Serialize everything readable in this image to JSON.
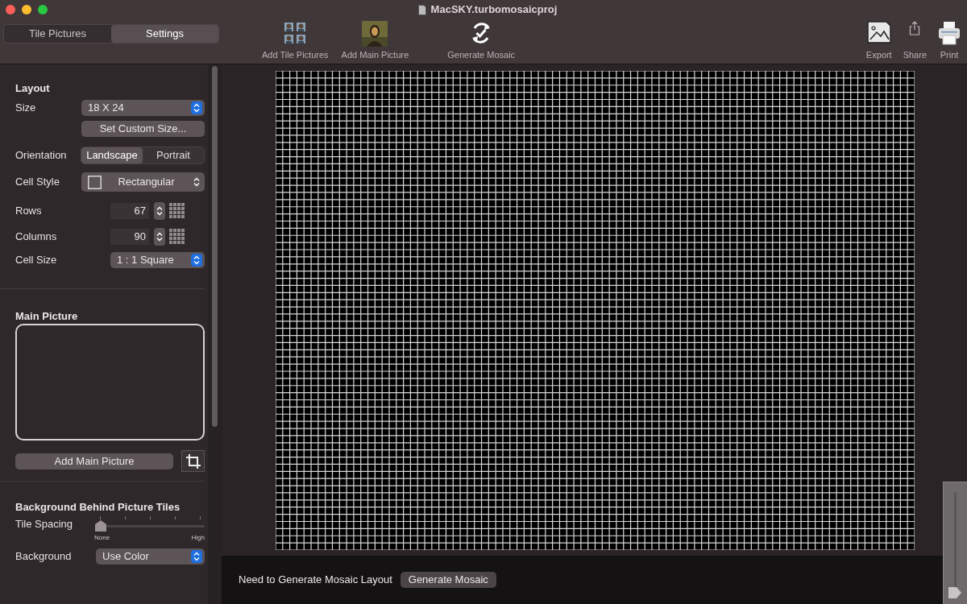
{
  "window": {
    "title": "MacSKY.turbomosaicproj"
  },
  "tabs": [
    {
      "label": "Tile Pictures",
      "selected": false
    },
    {
      "label": "Settings",
      "selected": true
    }
  ],
  "toolbar": {
    "left": [
      {
        "label": "Add Tile Pictures",
        "kind": "tiles"
      },
      {
        "label": "Add Main Picture",
        "kind": "portrait"
      },
      {
        "label": "Generate Mosaic",
        "kind": "generate"
      }
    ],
    "right": [
      {
        "label": "Export",
        "kind": "export"
      },
      {
        "label": "Share",
        "kind": "share"
      },
      {
        "label": "Print",
        "kind": "print"
      }
    ]
  },
  "layout": {
    "heading": "Layout",
    "size_label": "Size",
    "size_value": "18 X 24",
    "custom_size_button": "Set Custom Size...",
    "orientation_label": "Orientation",
    "orientations": [
      {
        "label": "Landscape",
        "selected": true
      },
      {
        "label": "Portrait",
        "selected": false
      }
    ],
    "cell_style_label": "Cell Style",
    "cell_style_value": "Rectangular",
    "rows_label": "Rows",
    "rows_value": "67",
    "columns_label": "Columns",
    "columns_value": "90",
    "cell_size_label": "Cell Size",
    "cell_size_value": "1 : 1 Square"
  },
  "main_picture": {
    "heading": "Main Picture",
    "button": "Add Main Picture"
  },
  "background": {
    "heading": "Background Behind Picture Tiles",
    "spacing_label": "Tile Spacing",
    "tile_spacing": {
      "level": 0
    },
    "spacing_min": "None",
    "spacing_max": "High",
    "background_label": "Background",
    "background_value": "Use Color"
  },
  "status": {
    "message": "Need to Generate Mosaic Layout",
    "button": "Generate Mosaic"
  },
  "zoom": {
    "level": 0
  }
}
